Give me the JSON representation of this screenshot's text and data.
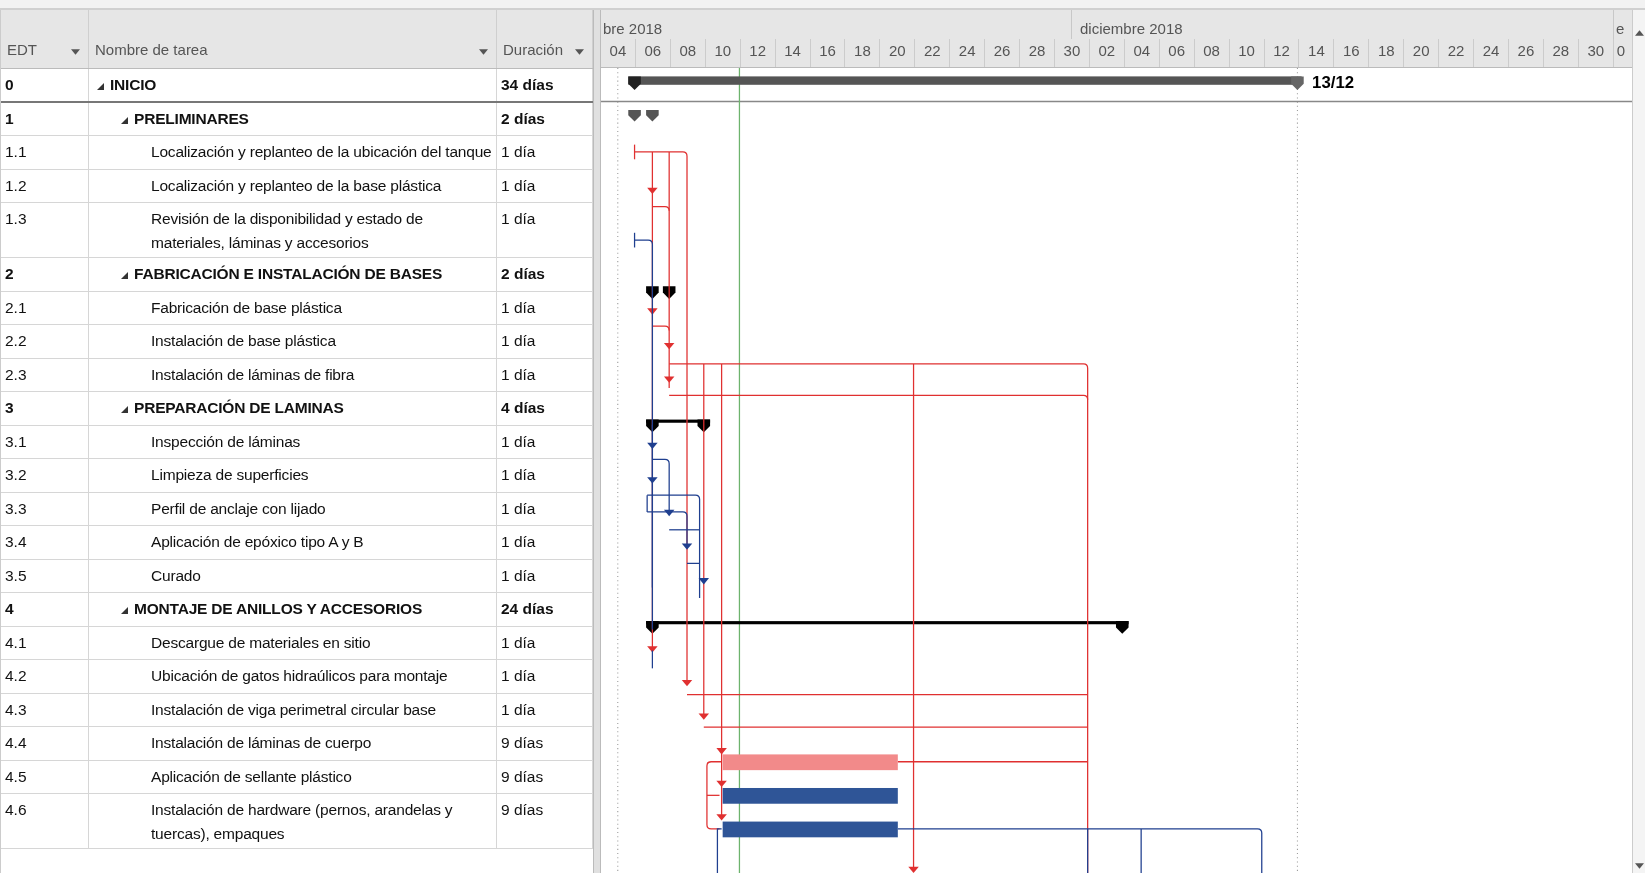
{
  "columns": [
    {
      "label": "EDT"
    },
    {
      "label": "Nombre de tarea"
    },
    {
      "label": "Duración"
    }
  ],
  "timescale": {
    "months": [
      {
        "label": "bre 2018"
      },
      {
        "label": "diciembre 2018"
      },
      {
        "label": "e"
      }
    ],
    "days": [
      "04",
      "06",
      "08",
      "10",
      "12",
      "14",
      "16",
      "18",
      "20",
      "22",
      "24",
      "26",
      "28",
      "30",
      "02",
      "04",
      "06",
      "08",
      "10",
      "12",
      "14",
      "16",
      "18",
      "20",
      "22",
      "24",
      "26",
      "28",
      "30",
      "0"
    ]
  },
  "tasks": [
    {
      "wbs": "0",
      "name": "INICIO",
      "duration": "34 días",
      "expanded": true,
      "children": [
        {
          "wbs": "1",
          "name": "PRELIMINARES",
          "duration": "2 días",
          "expanded": true,
          "children": [
            {
              "wbs": "1.1",
              "name": "Localización y replanteo de la ubicación del tanque",
              "duration": "1 día"
            },
            {
              "wbs": "1.2",
              "name": "Localización y replanteo de la base plástica",
              "duration": "1 día"
            },
            {
              "wbs": "1.3",
              "name": "Revisión de la disponibilidad y estado de materiales, láminas y accesorios",
              "duration": "1 día"
            }
          ]
        },
        {
          "wbs": "2",
          "name": "FABRICACIÓN E INSTALACIÓN DE BASES",
          "duration": "2 días",
          "expanded": true,
          "children": [
            {
              "wbs": "2.1",
              "name": "Fabricación de base plástica",
              "duration": "1 día"
            },
            {
              "wbs": "2.2",
              "name": "Instalación de base plástica",
              "duration": "1 día"
            },
            {
              "wbs": "2.3",
              "name": "Instalación de láminas de fibra",
              "duration": "1 día"
            }
          ]
        },
        {
          "wbs": "3",
          "name": "PREPARACIÓN DE LAMINAS",
          "duration": "4 días",
          "expanded": true,
          "children": [
            {
              "wbs": "3.1",
              "name": "Inspección de láminas",
              "duration": "1 día"
            },
            {
              "wbs": "3.2",
              "name": "Limpieza de superficies",
              "duration": "1 día"
            },
            {
              "wbs": "3.3",
              "name": "Perfil de anclaje con lijado",
              "duration": "1 día"
            },
            {
              "wbs": "3.4",
              "name": "Aplicación de epóxico tipo A y B",
              "duration": "1 día"
            },
            {
              "wbs": "3.5",
              "name": "Curado",
              "duration": "1 día"
            }
          ]
        },
        {
          "wbs": "4",
          "name": "MONTAJE DE ANILLOS Y ACCESORIOS",
          "duration": "24 días",
          "expanded": true,
          "children": [
            {
              "wbs": "4.1",
              "name": "Descargue de materiales en sitio",
              "duration": "1 día"
            },
            {
              "wbs": "4.2",
              "name": "Ubicación de gatos hidraúlicos para montaje",
              "duration": "1 día"
            },
            {
              "wbs": "4.3",
              "name": "Instalación de viga perimetral circular base",
              "duration": "1 día"
            },
            {
              "wbs": "4.4",
              "name": "Instalación de láminas de cuerpo",
              "duration": "9 días"
            },
            {
              "wbs": "4.5",
              "name": "Aplicación de sellante plástico",
              "duration": "9 días"
            },
            {
              "wbs": "4.6",
              "name": "Instalación de hardware (pernos, arandelas y tuercas), empaques",
              "duration": "9 días"
            }
          ]
        }
      ]
    }
  ],
  "gantt": {
    "finish_label": "13/12"
  }
}
